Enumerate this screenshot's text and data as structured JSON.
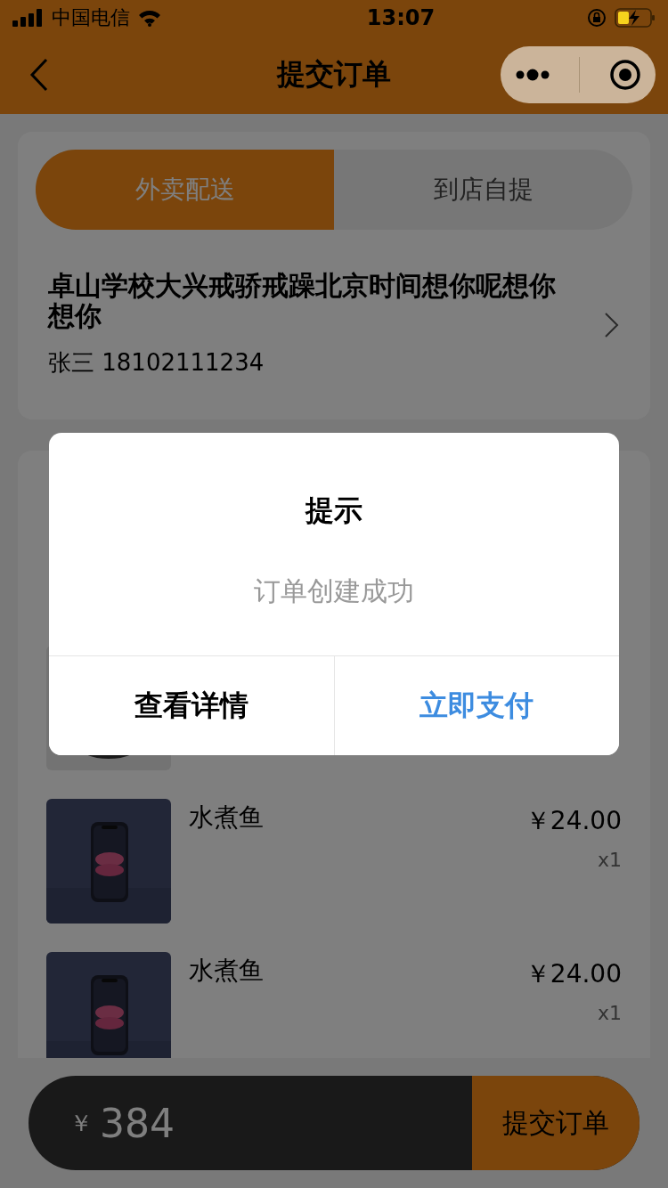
{
  "status_bar": {
    "carrier": "中国电信",
    "time": "13:07"
  },
  "nav": {
    "title": "提交订单"
  },
  "delivery_tabs": [
    {
      "label": "外卖配送",
      "selected": true
    },
    {
      "label": "到店自提",
      "selected": false
    }
  ],
  "address": {
    "text": "卓山学校大兴戒骄戒躁北京时间想你呢想你想你",
    "contact": "张三 18102111234"
  },
  "products": [
    {
      "kind": "picture_only"
    },
    {
      "kind": "full",
      "name": "水煮鱼",
      "price": "￥24.00",
      "quantity": "x1"
    },
    {
      "kind": "full",
      "name": "水煮鱼",
      "price": "￥24.00",
      "quantity": "x1"
    }
  ],
  "bottom_bar": {
    "currency": "￥",
    "total": "384",
    "submit": "提交订单"
  },
  "dialog": {
    "title": "提示",
    "message": "订单创建成功",
    "buttons": [
      {
        "label": "查看详情",
        "kind": "cancel"
      },
      {
        "label": "立即支付",
        "kind": "confirm"
      }
    ]
  }
}
